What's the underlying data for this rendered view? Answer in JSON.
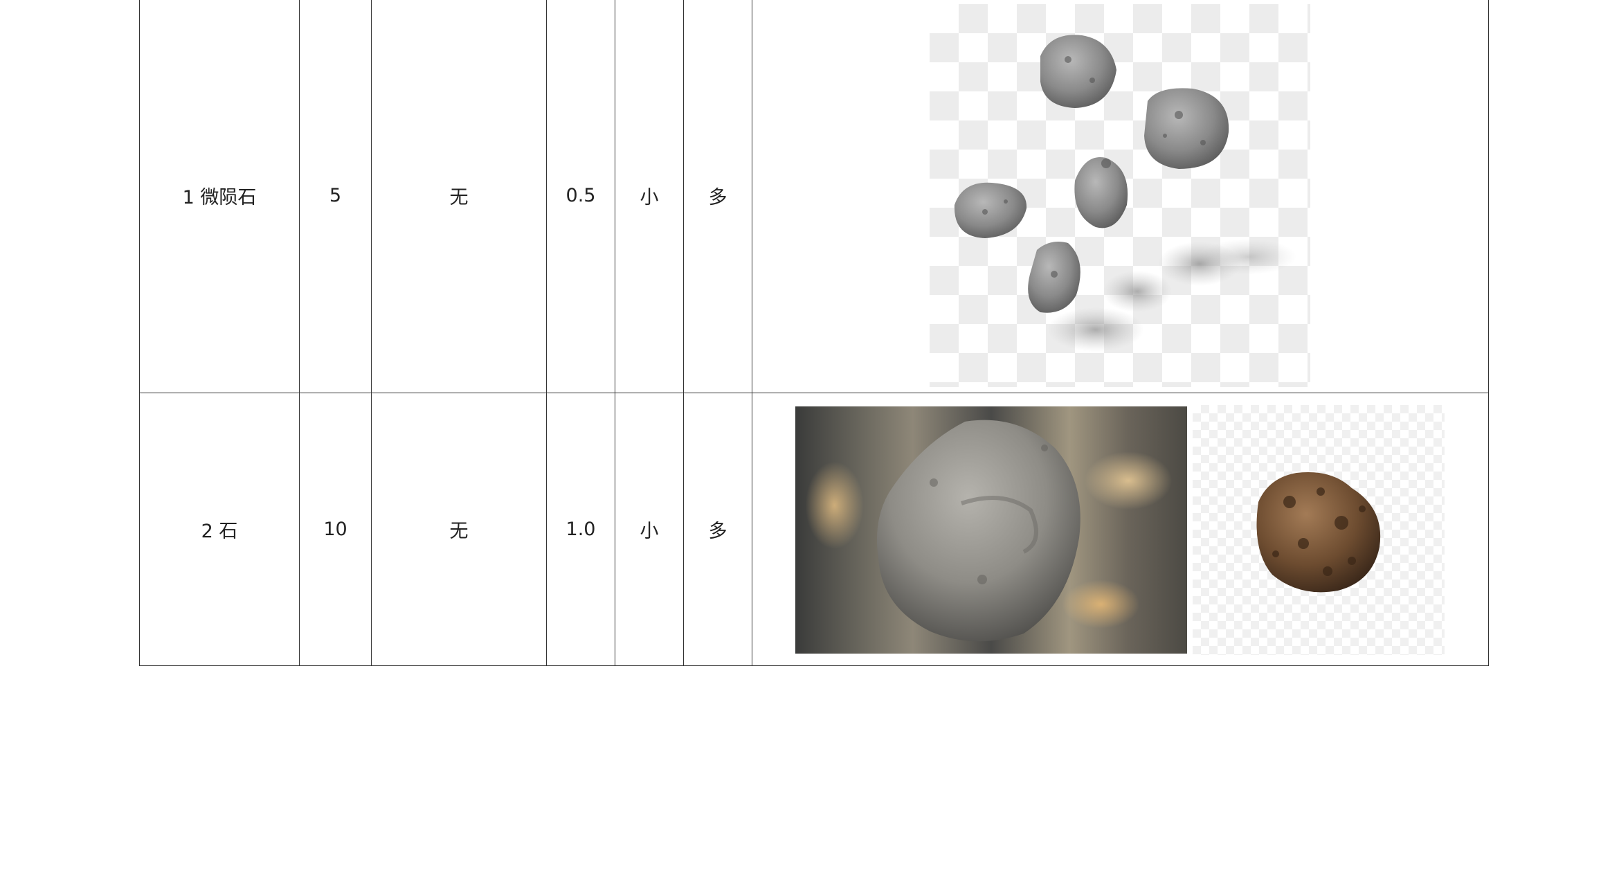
{
  "rows": [
    {
      "name": "1 微陨石",
      "col2": "5",
      "col3": "无",
      "col4": "0.5",
      "col5": "小",
      "col6": "多"
    },
    {
      "name": "2 石",
      "col2": "10",
      "col3": "无",
      "col4": "1.0",
      "col5": "小",
      "col6": "多"
    }
  ],
  "images": {
    "row1": "multiple-gray-meteorites-icon",
    "row2_left": "gray-rock-render-icon",
    "row2_right": "brown-meteorite-icon"
  }
}
